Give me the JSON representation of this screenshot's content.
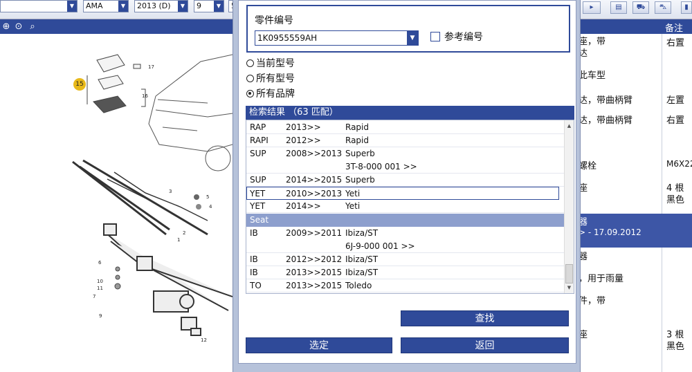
{
  "toolbar": {
    "model_value": "AMA",
    "year_value": "2013 (D)",
    "cat_value": "9",
    "extra_value": "5"
  },
  "dialog": {
    "part_label": "零件编号",
    "part_value": "1K0955559AH",
    "ref_label": "参考编号",
    "radio_current": "当前型号",
    "radio_all_models": "所有型号",
    "radio_all_brands": "所有品牌",
    "results_header": "检索结果 （63 匹配）",
    "search_button": "查找",
    "select_button": "选定",
    "back_button": "返回"
  },
  "results": [
    {
      "code": "RAP",
      "years": "2013>>",
      "name": "Rapid"
    },
    {
      "code": "RAPI",
      "years": "2012>>",
      "name": "Rapid"
    },
    {
      "code": "SUP",
      "years": "2008>>2013",
      "name": "Superb"
    },
    {
      "code": "",
      "years": "",
      "name": "3T-8-000 001 >>"
    },
    {
      "code": "SUP",
      "years": "2014>>2015",
      "name": "Superb"
    },
    {
      "code": "YET",
      "years": "2010>>2013",
      "name": "Yeti"
    },
    {
      "code": "YET",
      "years": "2014>>",
      "name": "Yeti"
    },
    {
      "group": "Seat"
    },
    {
      "code": "IB",
      "years": "2009>>2011",
      "name": "Ibiza/ST"
    },
    {
      "code": "",
      "years": "",
      "name": "6J-9-000 001 >>"
    },
    {
      "code": "IB",
      "years": "2012>>2012",
      "name": "Ibiza/ST"
    },
    {
      "code": "IB",
      "years": "2013>>2015",
      "name": "Ibiza/ST"
    },
    {
      "code": "TO",
      "years": "2013>>2015",
      "name": "Toledo"
    }
  ],
  "right_table": {
    "header_note": "备注",
    "texts": [
      "座，带",
      "达",
      "右置",
      "此车型",
      "达，带曲柄臂",
      "左置",
      "达，带曲柄臂",
      "右置",
      "螺栓",
      "M6X22",
      "座",
      "4 根",
      "黑色",
      "器",
      "> - 17.09.2012",
      "器",
      "，用于雨量",
      "件，带",
      "座",
      "3 根",
      "黑色"
    ]
  },
  "diagram": {
    "labels": [
      "15",
      "17",
      "16",
      "3",
      "5",
      "4",
      "2",
      "1",
      "6",
      "10",
      "11",
      "7",
      "9",
      "12"
    ]
  },
  "colors": {
    "accent": "#2f4a99",
    "group_row": "#8d9fcd",
    "callout": "#e8b91a"
  }
}
